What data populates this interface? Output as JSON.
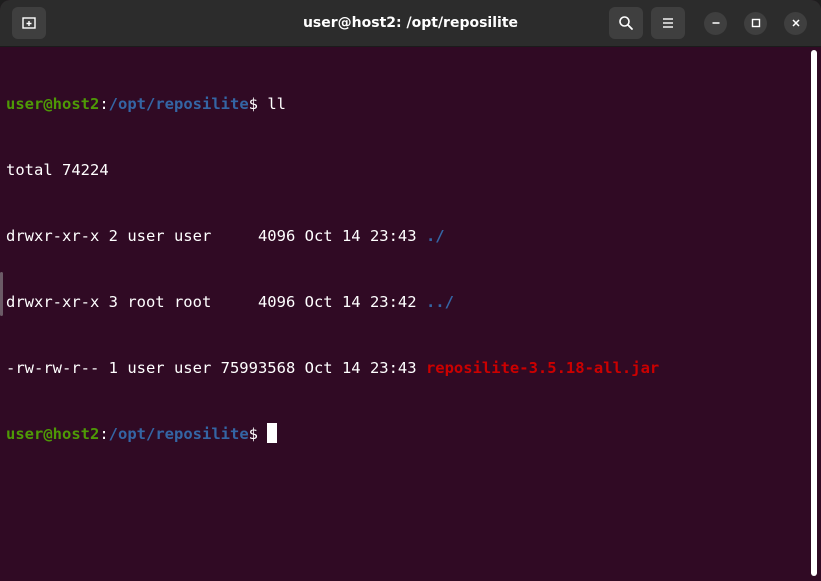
{
  "window": {
    "title": "user@host2: /opt/reposilite"
  },
  "terminal": {
    "prompt1": {
      "user_host": "user@host2",
      "colon": ":",
      "path": "/opt/reposilite",
      "dollar": "$ ",
      "command": "ll"
    },
    "total_line": "total 74224",
    "entries": [
      {
        "meta": "drwxr-xr-x 2 user user     4096 Oct 14 23:43 ",
        "name": "./",
        "type": "dir"
      },
      {
        "meta": "drwxr-xr-x 3 root root     4096 Oct 14 23:42 ",
        "name": "../",
        "type": "dir"
      },
      {
        "meta": "-rw-rw-r-- 1 user user 75993568 Oct 14 23:43 ",
        "name": "reposilite-3.5.18-all.jar",
        "type": "archive"
      }
    ],
    "prompt2": {
      "user_host": "user@host2",
      "colon": ":",
      "path": "/opt/reposilite",
      "dollar": "$ "
    }
  },
  "colors": {
    "background": "#300a24",
    "prompt_user": "#4e9a06",
    "prompt_path": "#3465a4",
    "archive": "#cc0000",
    "titlebar": "#2c2c2c"
  },
  "icons": {
    "new_tab": "new-tab-icon",
    "search": "search-icon",
    "menu": "hamburger-menu-icon",
    "minimize": "minimize-icon",
    "maximize": "maximize-icon",
    "close": "close-icon"
  }
}
